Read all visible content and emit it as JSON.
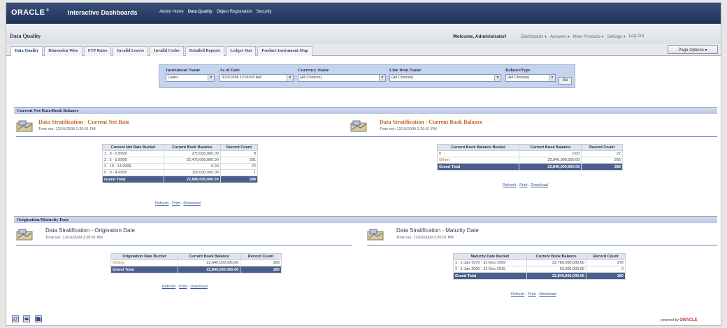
{
  "header": {
    "logo": "ORACLE",
    "logo_mark": "®",
    "app_title": "Interactive Dashboards",
    "nav": [
      "Admin Home",
      "Data Quality",
      "Object Registration",
      "Security"
    ]
  },
  "subheader": {
    "page_name": "Data Quality",
    "welcome": "Welcome, Administrator!",
    "links": [
      "Dashboards ▾",
      "Answers ▾",
      "More Products ▾",
      "Settings ▾",
      "Log Out"
    ]
  },
  "tabs": [
    "Data Quality",
    "Dimension Wise",
    "FTP Rates",
    "Invalid Leaves",
    "Invalid Codes",
    "Detailed Reports",
    "Ledger Stat",
    "Product Instrument Map"
  ],
  "page_options": "Page Options ▾",
  "prompts": {
    "instrument_label": "Instrument Name",
    "instrument_value": "Loans",
    "asof_label": "As of Date",
    "asof_value": "3/31/1998 12:00:00 AM",
    "currency_label": "Currency Name",
    "currency_value": "(All Choices)",
    "lineitem_label": "Line Item Name",
    "lineitem_value": "(All Choices)",
    "balance_label": "BalanceType",
    "balance_value": "(All Choices)",
    "go": "Go"
  },
  "sections": {
    "s1": "Current Net Rate/Book Balance",
    "s2": "Origination/Maturity Date"
  },
  "reports": {
    "net_rate": {
      "title": "Data Stratification - Current Net Rate",
      "time": "Time run: 12/15/2009 2:20:51 PM",
      "headers": [
        "Current Net Rate Bucket",
        "Current Book Balance",
        "Record Count"
      ],
      "rows": [
        [
          "1 . 0 - 0.9999",
          "270,000,000.00",
          "8"
        ],
        [
          "2 . 5 - 9.9999",
          "22,470,000,000.00",
          "291"
        ],
        [
          "3 . 10 - 14.9999",
          "0.00",
          "22"
        ],
        [
          "5 . 0 - 4.9999",
          "100,000,000.00",
          "1"
        ]
      ],
      "total": [
        "Grand Total",
        "22,840,000,000.00",
        "288"
      ]
    },
    "book_balance": {
      "title": "Data Stratification - Current Book Balance",
      "time": "Time run: 12/15/2009 2:20:51 PM",
      "headers": [
        "Current Book Balance Bucket",
        "Current Book Balance",
        "Record Count"
      ],
      "rows": [
        [
          "0",
          "0.00",
          "22"
        ],
        [
          "Others",
          "22,840,000,000.00",
          "266"
        ]
      ],
      "total": [
        "Grand Total",
        "22,840,000,000.00",
        "288"
      ]
    },
    "origination": {
      "title": "Data Stratification - Origination Date",
      "time": "Time run: 12/15/2009 2:20:51 PM",
      "headers": [
        "Origination Date Bucket",
        "Current Book Balance",
        "Record Count"
      ],
      "rows": [
        [
          "Others",
          "22,840,000,000.00",
          "280"
        ]
      ],
      "total": [
        "Grand Total",
        "22,840,000,000.00",
        "280"
      ]
    },
    "maturity": {
      "title": "Data Stratification - Maturity Date",
      "time": "Time run: 12/15/2009 2:20:51 PM",
      "headers": [
        "Maturity Date Bucket",
        "Current Book Balance",
        "Record Count"
      ],
      "rows": [
        [
          "1 . 1-Jan-1970 - 31-Dec-1999",
          "22,780,000,000.00",
          "278"
        ],
        [
          "2 . 1-Jan-2000 - 31-Dec-2015",
          "60,000,000.00",
          "2"
        ]
      ],
      "total": [
        "Grand Total",
        "22,840,000,000.00",
        "280"
      ]
    }
  },
  "links": {
    "refresh": "Refresh",
    "print": "Print",
    "download": "Download",
    "sep": " - "
  },
  "footer": {
    "powered_by": "powered by",
    "brand": "ORACLE"
  },
  "colors": {
    "accent": "#c06a23",
    "navy": "#1f3057",
    "grand_total": "#4b5f8c"
  }
}
